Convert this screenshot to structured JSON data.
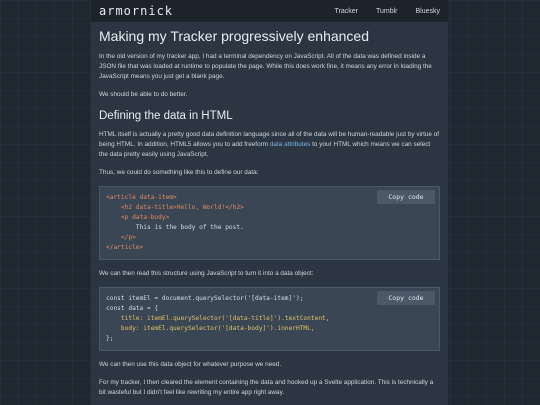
{
  "header": {
    "brand": "armornick",
    "nav": [
      "Tracker",
      "Tumblr",
      "Bluesky"
    ]
  },
  "article": {
    "title": "Making my Tracker progressively enhanced",
    "p1": "In the old version of my tracker app, I had a terminal dependency on JavaScript. All of the data was defined inside a JSON file that was loaded at runtime to populate the page. While this does work fine, it means any error in loading the JavaScript means you just get a blank page.",
    "p2": "We should be able to do better.",
    "h2": "Defining the data in HTML",
    "p3_a": "HTML itself is actually a pretty good data definition language since all of the data will be human-readable just by virtue of being HTML. In addition, HTML5 allows you to add freeform ",
    "p3_link": "data attributes",
    "p3_b": " to your HTML which means we can select the data pretty easily using JavaScript.",
    "p4": "Thus, we could do something like this to define our data:",
    "copy_label": "Copy code",
    "code1": [
      "<article data-item>",
      "    <h2 data-title>Hello, World!</h2>",
      "    <p data-body>",
      "        This is the body of the post.",
      "    </p>",
      "</article>"
    ],
    "p5": "We can then read this structure using JavaScript to turn it into a data object:",
    "code2": [
      "const itemEl = document.querySelector('[data-item]');",
      "const data = {",
      "    title: itemEl.querySelector('[data-title]').textContent,",
      "    body: itemEl.querySelector('[data-body]').innerHTML,",
      "};"
    ],
    "p6": "We can then use this data object for whatever purpose we need.",
    "p7": "For my tracker, I then cleared the element containing the data and hooked up a Svelte application. This is technically a bit wasteful but I didn't feel like rewriting my entire app right away."
  }
}
